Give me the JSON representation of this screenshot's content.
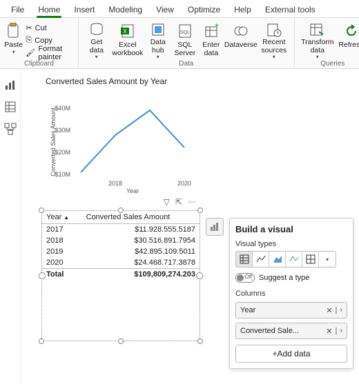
{
  "tabs": [
    "File",
    "Home",
    "Insert",
    "Modeling",
    "View",
    "Optimize",
    "Help",
    "External tools"
  ],
  "active_tab": 1,
  "ribbon": {
    "clipboard": {
      "paste": "Paste",
      "cut": "Cut",
      "copy": "Copy",
      "format_painter": "Format painter",
      "group": "Clipboard"
    },
    "data": {
      "get_data": "Get data",
      "excel": "Excel workbook",
      "data_hub": "Data hub",
      "sql": "SQL Server",
      "enter": "Enter data",
      "dataverse": "Dataverse",
      "recent": "Recent sources",
      "group": "Data"
    },
    "queries": {
      "transform": "Transform data",
      "refresh": "Refresh",
      "group": "Queries"
    }
  },
  "chart_data": {
    "type": "line",
    "title": "Converted Sales Amount by Year",
    "xlabel": "Year",
    "ylabel": "Converted Sales Amount",
    "categories": [
      "2018",
      "2020"
    ],
    "y_ticks": [
      "$10M",
      "$20M",
      "$30M",
      "$40M"
    ],
    "x": [
      2017,
      2018,
      2019,
      2020
    ],
    "values": [
      11.93,
      30.52,
      42.9,
      24.47
    ],
    "ylim": [
      10,
      45
    ]
  },
  "table": {
    "headers": [
      "Year",
      "Converted Sales Amount"
    ],
    "rows": [
      {
        "year": "2017",
        "amount": "$11.928.555.5187"
      },
      {
        "year": "2018",
        "amount": "$30.516.891.7954"
      },
      {
        "year": "2019",
        "amount": "$42.895.109.5011"
      },
      {
        "year": "2020",
        "amount": "$24.468.717.3878"
      }
    ],
    "total_label": "Total",
    "total_value": "$109,809,274.203"
  },
  "visual_panel": {
    "title": "Build a visual",
    "types_label": "Visual types",
    "suggest": "Suggest a type",
    "toggle_state": "Off",
    "columns_label": "Columns",
    "fields": [
      "Year",
      "Converted Sale..."
    ],
    "add": "+Add data"
  }
}
